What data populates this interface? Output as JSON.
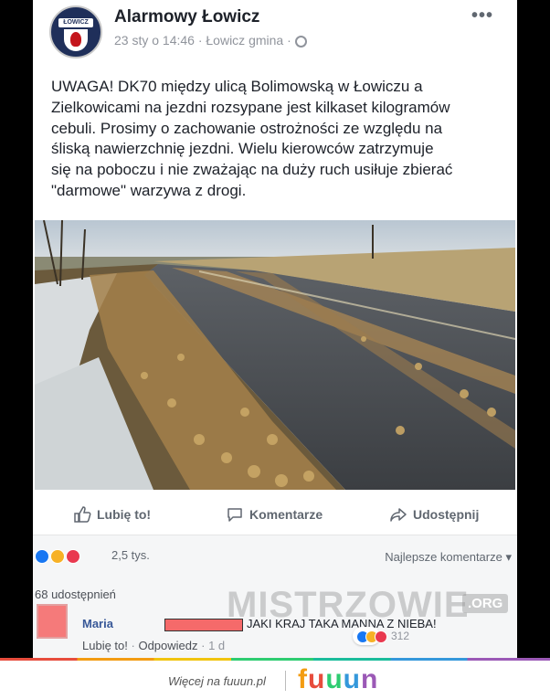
{
  "post": {
    "page_name": "Alarmowy Łowicz",
    "logo_text": "ŁOWICZ",
    "meta": "23 sty o 14:46 · Łowicz gmina ·",
    "more": "•••",
    "text_lines": [
      "UWAGA! DK70 między ulicą Bolimowską w Łowiczu a",
      "Zielkowicami na jezdni rozsypane jest kilkaset kilogramów",
      "cebuli. Prosimy o zachowanie ostrożności ze względu na",
      "śliską nawierzchnię jezdni. Wielu kierowców zatrzymuje",
      "się na poboczu i nie zważając na duży ruch usiłuje zbierać",
      "\"darmowe\" warzywa z drogi."
    ]
  },
  "actions": {
    "like": "Lubię to!",
    "comment": "Komentarze",
    "share": "Udostępnij"
  },
  "reactions": {
    "count": "2,5 tys.",
    "sort": "Najlepsze komentarze ▾",
    "colors": {
      "like": "#1877f2",
      "haha": "#f7b125",
      "love": "#e9394f"
    }
  },
  "comments": {
    "shares": "68 udostępnień",
    "comment": {
      "name": "Maria",
      "text": "JAKI KRAJ TAKA MANNA Z NIEBA!",
      "like": "Lubię to!",
      "reply": "Odpowiedz",
      "time": "1 d",
      "reaction_count": "312"
    }
  },
  "watermark": {
    "text": "MISTRZOWIE",
    "org": ".ORG"
  },
  "footer": {
    "more": "Więcej na fuuun.pl",
    "brand_letters": [
      "f",
      "u",
      "u",
      "u",
      "n"
    ],
    "brand_colors": [
      "#f39c12",
      "#e74c3c",
      "#2ecc71",
      "#3498db",
      "#9b59b6"
    ]
  }
}
